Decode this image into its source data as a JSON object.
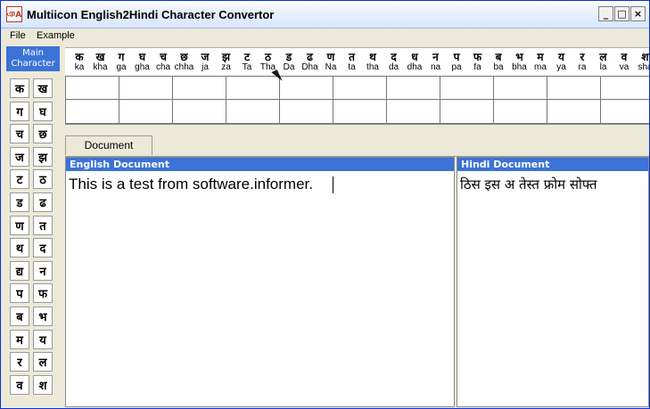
{
  "window": {
    "title": "Multiicon English2Hindi Character Convertor",
    "icon_text": "ঞA",
    "controls": {
      "minimize": "_",
      "maximize": "□",
      "close": "×"
    }
  },
  "menu": [
    "File",
    "Example"
  ],
  "left_panel": {
    "title_line1": "Main",
    "title_line2": "Character",
    "characters": [
      "क",
      "ख",
      "ग",
      "घ",
      "च",
      "छ",
      "ज",
      "झ",
      "ट",
      "ठ",
      "ड",
      "ढ",
      "ण",
      "त",
      "थ",
      "द",
      "द्य",
      "न",
      "प",
      "फ",
      "ब",
      "भ",
      "म",
      "य",
      "र",
      "ल",
      "व",
      "श"
    ]
  },
  "header_characters": [
    {
      "hindi": "क",
      "latin": "ka"
    },
    {
      "hindi": "ख",
      "latin": "kha"
    },
    {
      "hindi": "ग",
      "latin": "ga"
    },
    {
      "hindi": "घ",
      "latin": "gha"
    },
    {
      "hindi": "च",
      "latin": "cha"
    },
    {
      "hindi": "छ",
      "latin": "chha"
    },
    {
      "hindi": "ज",
      "latin": "ja"
    },
    {
      "hindi": "झ",
      "latin": "za"
    },
    {
      "hindi": "ट",
      "latin": "Ta"
    },
    {
      "hindi": "ठ",
      "latin": "Tha"
    },
    {
      "hindi": "ड",
      "latin": "Da"
    },
    {
      "hindi": "ढ",
      "latin": "Dha"
    },
    {
      "hindi": "ण",
      "latin": "Na"
    },
    {
      "hindi": "त",
      "latin": "ta"
    },
    {
      "hindi": "थ",
      "latin": "tha"
    },
    {
      "hindi": "द",
      "latin": "da"
    },
    {
      "hindi": "ध",
      "latin": "dha"
    },
    {
      "hindi": "न",
      "latin": "na"
    },
    {
      "hindi": "प",
      "latin": "pa"
    },
    {
      "hindi": "फ",
      "latin": "fa"
    },
    {
      "hindi": "ब",
      "latin": "ba"
    },
    {
      "hindi": "भ",
      "latin": "bha"
    },
    {
      "hindi": "म",
      "latin": "ma"
    },
    {
      "hindi": "य",
      "latin": "ya"
    },
    {
      "hindi": "र",
      "latin": "ra"
    },
    {
      "hindi": "ल",
      "latin": "la"
    },
    {
      "hindi": "व",
      "latin": "va"
    },
    {
      "hindi": "श",
      "latin": "sha"
    }
  ],
  "tabs": {
    "document": "Document"
  },
  "english_document": {
    "title": "English Document",
    "text": "This is a test from software.informer."
  },
  "hindi_document": {
    "title": "Hindi Document",
    "text": "ठिस इस अ तेस्त फ्रोम सोफ्त"
  },
  "colors": {
    "title_bar": "#d8e6ff",
    "header_blue": "#3b73d6",
    "window_bg": "#ece9d8"
  }
}
